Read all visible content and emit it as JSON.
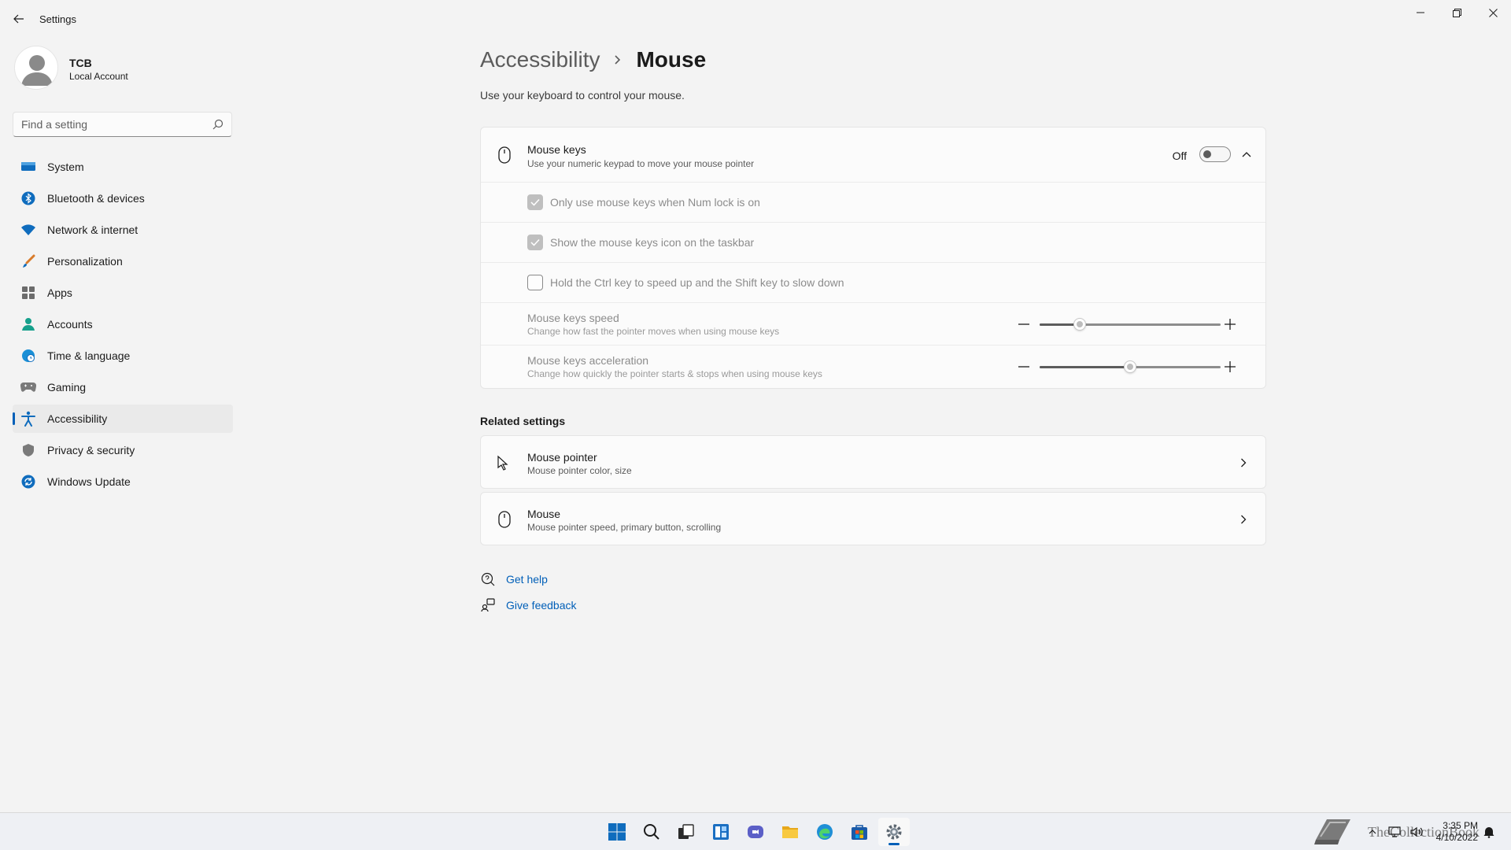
{
  "window": {
    "title": "Settings"
  },
  "profile": {
    "name": "TCB",
    "account_type": "Local Account"
  },
  "search": {
    "placeholder": "Find a setting"
  },
  "sidebar": {
    "items": [
      {
        "label": "System",
        "icon": "monitor-icon"
      },
      {
        "label": "Bluetooth & devices",
        "icon": "bluetooth-icon"
      },
      {
        "label": "Network & internet",
        "icon": "wifi-icon"
      },
      {
        "label": "Personalization",
        "icon": "brush-icon"
      },
      {
        "label": "Apps",
        "icon": "apps-icon"
      },
      {
        "label": "Accounts",
        "icon": "person-icon"
      },
      {
        "label": "Time & language",
        "icon": "globe-clock-icon"
      },
      {
        "label": "Gaming",
        "icon": "gamepad-icon"
      },
      {
        "label": "Accessibility",
        "icon": "accessibility-icon",
        "active": true
      },
      {
        "label": "Privacy & security",
        "icon": "shield-icon"
      },
      {
        "label": "Windows Update",
        "icon": "update-icon"
      }
    ]
  },
  "breadcrumb": {
    "parent": "Accessibility",
    "current": "Mouse"
  },
  "subtitle": "Use your keyboard to control your mouse.",
  "mouse_keys": {
    "title": "Mouse keys",
    "description": "Use your numeric keypad to move your mouse pointer",
    "state_label": "Off",
    "enabled": false,
    "options": [
      {
        "label": "Only use mouse keys when Num lock is on",
        "checked": true
      },
      {
        "label": "Show the mouse keys icon on the taskbar",
        "checked": true
      },
      {
        "label": "Hold the Ctrl key to speed up and the Shift key to slow down",
        "checked": false
      }
    ],
    "speed": {
      "title": "Mouse keys speed",
      "description": "Change how fast the pointer moves when using mouse keys",
      "value_fraction": 0.22
    },
    "acceleration": {
      "title": "Mouse keys acceleration",
      "description": "Change how quickly the pointer starts & stops when using mouse keys",
      "value_fraction": 0.5
    }
  },
  "related": {
    "title": "Related settings",
    "items": [
      {
        "title": "Mouse pointer",
        "description": "Mouse pointer color, size",
        "icon": "mouse-pointer-icon"
      },
      {
        "title": "Mouse",
        "description": "Mouse pointer speed, primary button, scrolling",
        "icon": "mouse-icon"
      }
    ]
  },
  "help": {
    "get_help": "Get help",
    "feedback": "Give feedback"
  },
  "taskbar": {
    "apps": [
      "start-icon",
      "search-icon",
      "task-view-icon",
      "widgets-icon",
      "chat-icon",
      "file-explorer-icon",
      "edge-icon",
      "store-icon",
      "settings-icon"
    ],
    "clock_time": "3:35 PM",
    "clock_date": "4/10/2022",
    "watermark": "TheCollectionBook"
  },
  "colors": {
    "accent": "#005fb8",
    "background": "#f3f3f3",
    "card": "#fbfbfb"
  }
}
